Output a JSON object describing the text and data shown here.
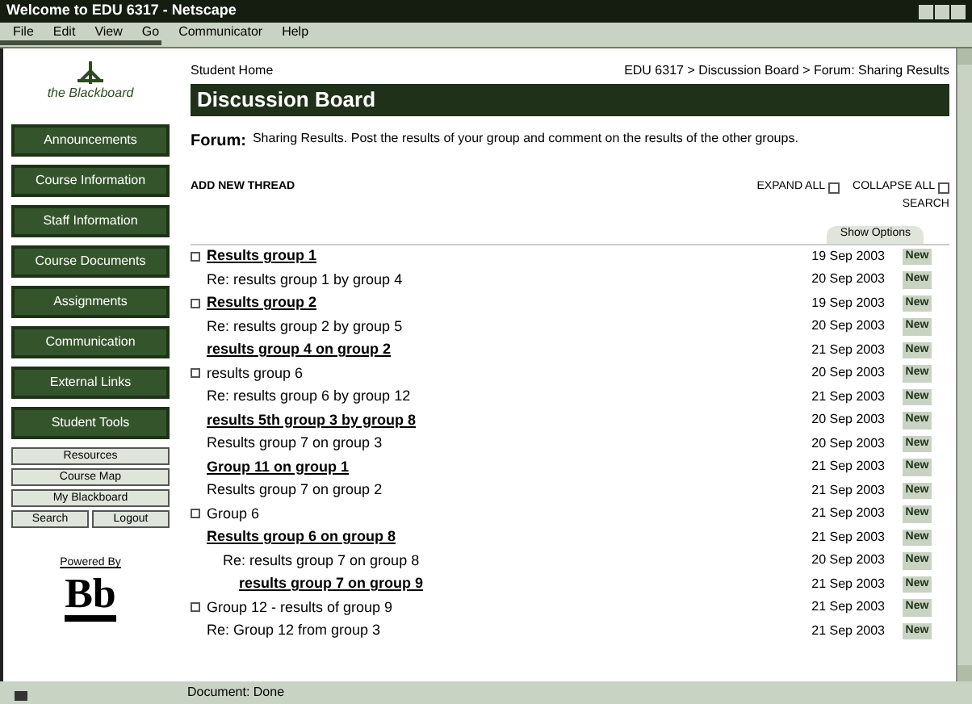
{
  "window": {
    "title": "Welcome to EDU 6317 - Netscape"
  },
  "menu": [
    "File",
    "Edit",
    "View",
    "Go",
    "Communicator",
    "Help"
  ],
  "sidebar": {
    "logo_text": "the Blackboard",
    "buttons": [
      "Announcements",
      "Course Information",
      "Staff Information",
      "Course Documents",
      "Assignments",
      "Communication",
      "External Links",
      "Student Tools"
    ],
    "small_buttons": [
      "Resources",
      "Course Map",
      "My Blackboard"
    ],
    "pair_buttons": [
      "Search",
      "Logout"
    ],
    "powered_by": "Powered By",
    "logo_mark": "Bb"
  },
  "breadcrumb": "Student Home",
  "breadcrumb_right": "EDU 6317 > Discussion Board > Forum: Sharing Results",
  "heading": "Discussion Board",
  "forum": {
    "label": "Forum:",
    "text": "Sharing Results. Post the results of your group and comment on the results of the other groups."
  },
  "add_link": "ADD NEW THREAD",
  "options": [
    {
      "label": "EXPAND ALL",
      "checked": false
    },
    {
      "label": "COLLAPSE ALL",
      "checked": false
    }
  ],
  "search_link": "SEARCH",
  "options_tab": "Show Options",
  "threads": [
    {
      "title": "Results group 1",
      "kind": "link",
      "date": "19 Sep 2003",
      "badge": "New",
      "children": [
        {
          "title": "Re: results group 1 by group 4",
          "kind": "text",
          "date": "20 Sep 2003",
          "badge": "New"
        }
      ]
    },
    {
      "title": "Results group 2",
      "kind": "link",
      "date": "19 Sep 2003",
      "badge": "New",
      "children": [
        {
          "title": "Re: results group 2 by group 5",
          "kind": "text",
          "date": "20 Sep 2003",
          "badge": "New"
        },
        {
          "title": "results group 4 on group 2",
          "kind": "link",
          "date": "21 Sep 2003",
          "badge": "New"
        }
      ]
    },
    {
      "title": "results group 6",
      "kind": "text",
      "date": "20 Sep 2003",
      "badge": "New",
      "children": [
        {
          "title": "Re: results group 6 by group 12",
          "kind": "text",
          "date": "21 Sep 2003",
          "badge": "New"
        },
        {
          "title": "results 5th group 3 by group 8",
          "kind": "link",
          "date": "20 Sep 2003",
          "badge": "New"
        },
        {
          "title": "Results group 7 on group 3",
          "kind": "text",
          "date": "20 Sep 2003",
          "badge": "New"
        },
        {
          "title": "Group 11 on group 1",
          "kind": "link",
          "date": "21 Sep 2003",
          "badge": "New"
        },
        {
          "title": "Results group 7 on group 2",
          "kind": "text",
          "date": "21 Sep 2003",
          "badge": "New"
        }
      ]
    },
    {
      "title": "Group 6",
      "kind": "text",
      "date": "21 Sep 2003",
      "badge": "New",
      "children": [
        {
          "title": "Results group 6 on group 8",
          "kind": "link",
          "date": "21 Sep 2003",
          "badge": "New",
          "children": [
            {
              "title": "Re: results group 7 on group 8",
              "kind": "text",
              "date": "20 Sep 2003",
              "badge": "New",
              "children": [
                {
                  "title": "results group 7 on group 9",
                  "kind": "link",
                  "date": "21 Sep 2003",
                  "badge": "New"
                }
              ]
            }
          ]
        }
      ]
    },
    {
      "title": "Group 12 - results of group 9",
      "kind": "text",
      "date": "21 Sep 2003",
      "badge": "New",
      "children": [
        {
          "title": "Re: Group 12 from group 3",
          "kind": "text",
          "date": "21 Sep 2003",
          "badge": "New"
        }
      ]
    }
  ],
  "status_bar": {
    "text": "Document: Done"
  }
}
